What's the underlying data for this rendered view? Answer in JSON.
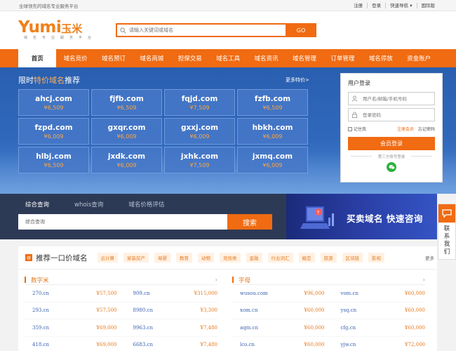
{
  "topbar": {
    "slogan": "全球领先的域名专业服务平台",
    "links": [
      "注册",
      "登录",
      "快速导航 ▾",
      "国际版"
    ]
  },
  "logo": {
    "brand": "Yumi",
    "brand_cn": "玉米",
    "tagline": "域 名 专 业 服 务 平 台"
  },
  "search": {
    "placeholder": "请输入关键词或域名",
    "button": "GO"
  },
  "nav": [
    "首页",
    "域名竞价",
    "域名预订",
    "域名商城",
    "担保交易",
    "域名工具",
    "域名资讯",
    "域名管理",
    "订单管理",
    "域名停放",
    "资金账户"
  ],
  "deals": {
    "title_prefix": "限时",
    "title_highlight": "特价域名",
    "title_suffix": "推荐",
    "more": "更多特价>",
    "items": [
      {
        "domain": "ahcj.com",
        "price": "¥6,509"
      },
      {
        "domain": "fjfb.com",
        "price": "¥6,509"
      },
      {
        "domain": "fqjd.com",
        "price": "¥7,509"
      },
      {
        "domain": "fzfb.com",
        "price": "¥6,509"
      },
      {
        "domain": "fzpd.com",
        "price": "¥6,009"
      },
      {
        "domain": "gxqr.com",
        "price": "¥6,009"
      },
      {
        "domain": "gxxj.com",
        "price": "¥6,009"
      },
      {
        "domain": "hbkh.com",
        "price": "¥6,009"
      },
      {
        "domain": "hlbj.com",
        "price": "¥6,509"
      },
      {
        "domain": "jxdk.com",
        "price": "¥6,009"
      },
      {
        "domain": "jxhk.com",
        "price": "¥7,509"
      },
      {
        "domain": "jxmq.com",
        "price": "¥6,009"
      }
    ]
  },
  "login": {
    "title": "用户登录",
    "username_placeholder": "用户名/邮箱/手机号码",
    "password_placeholder": "登录密码",
    "remember": "记住我",
    "register": "注册会员",
    "forgot": "忘记密码",
    "button": "会员登录",
    "third_party": "第三方账号登录"
  },
  "query": {
    "tabs": [
      "综合查询",
      "whois查询",
      "域名价格评估"
    ],
    "placeholder": "综合查询",
    "button": "搜索"
  },
  "ad": {
    "text": "买卖域名  快速咨询"
  },
  "float_contact": {
    "text": "联系我们"
  },
  "recommend": {
    "badge": "荐",
    "title": "推荐一口价域名",
    "tags": [
      "云计算",
      "家装房产",
      "母婴",
      "教育",
      "动物",
      "竞技类",
      "金融",
      "行业词汇",
      "婚恋",
      "旅游",
      "区块链",
      "影视"
    ],
    "more": "更多",
    "left": {
      "title": "数字米",
      "rows": [
        [
          {
            "domain": "270.cn",
            "price": "¥57,500"
          },
          {
            "domain": "909.cn",
            "price": "¥315,000"
          }
        ],
        [
          {
            "domain": "293.cn",
            "price": "¥57,500"
          },
          {
            "domain": "8980.cn",
            "price": "¥3,300"
          }
        ],
        [
          {
            "domain": "359.cn",
            "price": "¥69,000"
          },
          {
            "domain": "9963.cn",
            "price": "¥7,480"
          }
        ],
        [
          {
            "domain": "418.cn",
            "price": "¥69,000"
          },
          {
            "domain": "6683.cn",
            "price": "¥7,480"
          }
        ]
      ]
    },
    "right": {
      "title": "字母",
      "rows": [
        [
          {
            "domain": "wusou.com",
            "price": "¥96,000"
          },
          {
            "domain": "vom.cn",
            "price": "¥60,000"
          }
        ],
        [
          {
            "domain": "xom.cn",
            "price": "¥60,000"
          },
          {
            "domain": "ysq.cn",
            "price": "¥60,000"
          }
        ],
        [
          {
            "domain": "aqm.cn",
            "price": "¥60,000"
          },
          {
            "domain": "cfg.cn",
            "price": "¥60,000"
          }
        ],
        [
          {
            "domain": "lco.cn",
            "price": "¥60,000"
          },
          {
            "domain": "yjw.cn",
            "price": "¥72,000"
          }
        ]
      ]
    }
  },
  "colors": {
    "accent": "#f06b12",
    "banner": "#2f68bb",
    "price": "#e57a1f",
    "link": "#3a62b0"
  }
}
